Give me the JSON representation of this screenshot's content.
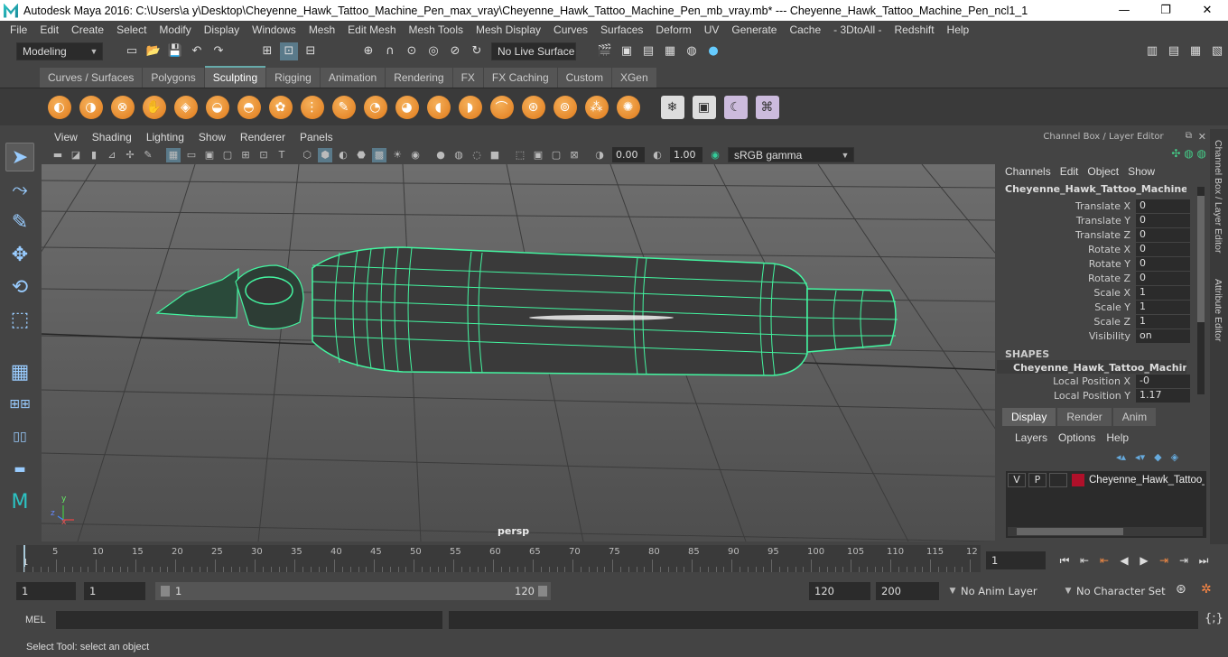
{
  "window": {
    "title": "Autodesk Maya 2016: C:\\Users\\a y\\Desktop\\Cheyenne_Hawk_Tattoo_Machine_Pen_max_vray\\Cheyenne_Hawk_Tattoo_Machine_Pen_mb_vray.mb*   ---   Cheyenne_Hawk_Tattoo_Machine_Pen_ncl1_1",
    "minimize": "—",
    "maximize": "❐",
    "close": "✕"
  },
  "menu": [
    "File",
    "Edit",
    "Create",
    "Select",
    "Modify",
    "Display",
    "Windows",
    "Mesh",
    "Edit Mesh",
    "Mesh Tools",
    "Mesh Display",
    "Curves",
    "Surfaces",
    "Deform",
    "UV",
    "Generate",
    "Cache",
    "- 3DtoAll -",
    "Redshift",
    "Help"
  ],
  "statusline": {
    "mode": "Modeling",
    "live_surface": "No Live Surface"
  },
  "shelf_tabs": [
    "Curves / Surfaces",
    "Polygons",
    "Sculpting",
    "Rigging",
    "Animation",
    "Rendering",
    "FX",
    "FX Caching",
    "Custom",
    "XGen"
  ],
  "shelf_active": "Sculpting",
  "panel_menu": [
    "View",
    "Shading",
    "Lighting",
    "Show",
    "Renderer",
    "Panels"
  ],
  "panel_toolbar": {
    "exposure": "0.00",
    "gamma": "1.00",
    "colorspace": "sRGB gamma"
  },
  "viewport": {
    "camera_label": "persp",
    "axis_x": "x",
    "axis_y": "y",
    "axis_z": "z"
  },
  "channel_box": {
    "header": "Channel Box / Layer Editor",
    "menu": [
      "Channels",
      "Edit",
      "Object",
      "Show"
    ],
    "object_name": "Cheyenne_Hawk_Tattoo_Machine_Pe...",
    "attributes": [
      {
        "name": "Translate X",
        "value": "0"
      },
      {
        "name": "Translate Y",
        "value": "0"
      },
      {
        "name": "Translate Z",
        "value": "0"
      },
      {
        "name": "Rotate X",
        "value": "0"
      },
      {
        "name": "Rotate Y",
        "value": "0"
      },
      {
        "name": "Rotate Z",
        "value": "0"
      },
      {
        "name": "Scale X",
        "value": "1"
      },
      {
        "name": "Scale Y",
        "value": "1"
      },
      {
        "name": "Scale Z",
        "value": "1"
      },
      {
        "name": "Visibility",
        "value": "on"
      }
    ],
    "shapes_label": "SHAPES",
    "shape_name": "Cheyenne_Hawk_Tattoo_Machine_P...",
    "shape_attributes": [
      {
        "name": "Local Position X",
        "value": "-0"
      },
      {
        "name": "Local Position Y",
        "value": "1.17"
      }
    ]
  },
  "side_tabs": {
    "channel_box": "Channel Box / Layer Editor",
    "attribute_editor": "Attribute Editor"
  },
  "layer_editor": {
    "tabs": [
      "Display",
      "Render",
      "Anim"
    ],
    "active_tab": "Display",
    "menu": [
      "Layers",
      "Options",
      "Help"
    ],
    "layer": {
      "v": "V",
      "p": "P",
      "name": "Cheyenne_Hawk_Tattoo_",
      "color": "#b0102a"
    }
  },
  "timeline": {
    "ticks": [
      "5",
      "10",
      "15",
      "20",
      "25",
      "30",
      "35",
      "40",
      "45",
      "50",
      "55",
      "60",
      "65",
      "70",
      "75",
      "80",
      "85",
      "90",
      "95",
      "100",
      "105",
      "110",
      "115",
      "12"
    ],
    "current_marker": "1",
    "current_frame": "1"
  },
  "range": {
    "start": "1",
    "playback_start": "1",
    "slider_start": "1",
    "slider_end": "120",
    "playback_end": "120",
    "end": "200",
    "anim_layer": "No Anim Layer",
    "character_set": "No Character Set"
  },
  "command_line": {
    "label": "MEL"
  },
  "help_line": "Select Tool: select an object",
  "colors": {
    "accent": "#5fa8b0",
    "wireframe": "#43f5a0",
    "layer_color": "#b0102a"
  }
}
